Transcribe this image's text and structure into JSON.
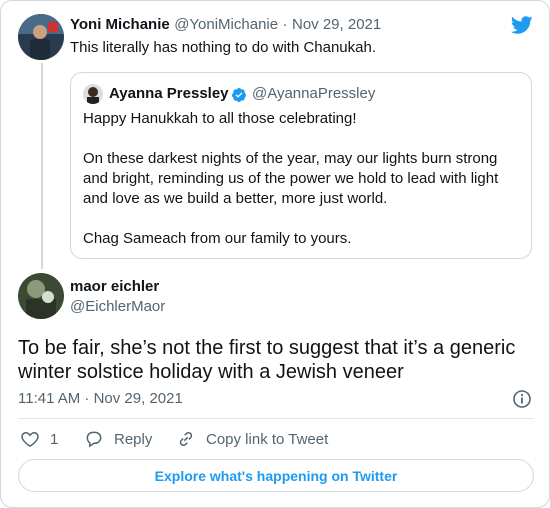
{
  "retweet": {
    "author_name": "Yoni Michanie",
    "author_handle": "@YoniMichanie",
    "separator": "·",
    "date": "Nov 29, 2021",
    "text": "This literally has nothing to do with Chanukah."
  },
  "quoted": {
    "author_name": "Ayanna Pressley",
    "author_handle": "@AyannaPressley",
    "line1": "Happy Hanukkah to all those celebrating!",
    "para2_line1": "On these darkest nights of the year, may our lights burn strong",
    "para2_line2": "and bright, reminding us of the power we hold to lead with light",
    "para2_line3": "and love as we build a better, more just world.",
    "para3": "Chag Sameach from our family to yours."
  },
  "main": {
    "author_name": "maor eichler",
    "author_handle": "@EichlerMaor",
    "text_line1": "To be fair, she’s not the first to suggest that it’s a generic",
    "text_line2": "winter solstice holiday with a Jewish veneer",
    "timestamp": "11:41 AM · Nov 29, 2021"
  },
  "actions": {
    "like_count": "1",
    "reply_label": "Reply",
    "copy_label": "Copy link to Tweet"
  },
  "explore_label": "Explore what's happening on Twitter",
  "colors": {
    "twitter_blue": "#1d9bf0",
    "text": "#0f1419",
    "muted": "#536471",
    "border": "#cfd9de"
  },
  "icons": [
    "twitter-bird-icon",
    "verified-badge-icon",
    "info-icon",
    "heart-icon",
    "reply-icon",
    "link-icon"
  ]
}
